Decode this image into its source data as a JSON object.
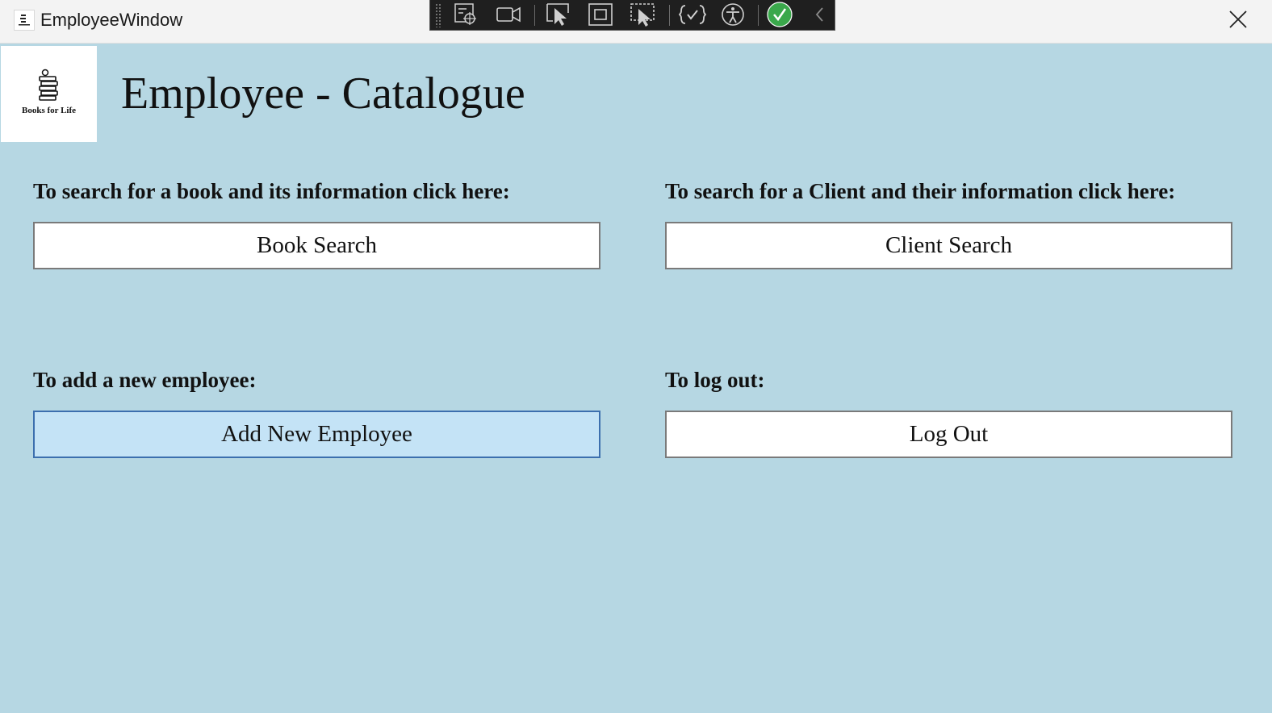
{
  "window": {
    "title": "EmployeeWindow"
  },
  "debug_toolbar": {
    "icons": [
      "grip-handle-icon",
      "visual-tree-icon",
      "video-camera-icon",
      "select-element-icon",
      "layout-adorner-icon",
      "track-focus-icon",
      "binding-check-icon",
      "accessibility-icon",
      "hot-reload-check-icon",
      "collapse-chevron-icon"
    ]
  },
  "logo": {
    "text": "Books for Life"
  },
  "page": {
    "title": "Employee - Catalogue"
  },
  "sections": {
    "book": {
      "prompt": "To search for a book and its information click here:",
      "button": "Book Search"
    },
    "client": {
      "prompt": "To search for a Client and their information click here:",
      "button": "Client Search"
    },
    "employee": {
      "prompt": "To add a new employee:",
      "button": "Add New Employee"
    },
    "logout": {
      "prompt": "To log out:",
      "button": "Log Out"
    }
  },
  "colors": {
    "background": "#b6d7e3",
    "hover_button": "#c4e3f6",
    "hover_border": "#3c6fae",
    "hot_reload_green": "#3aa84b"
  }
}
